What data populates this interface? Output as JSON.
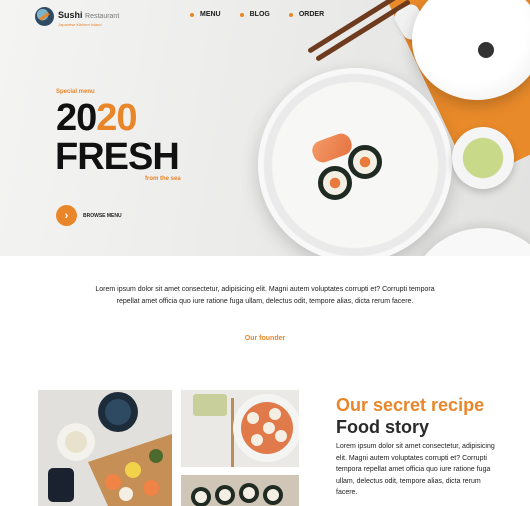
{
  "brand": {
    "name": "Sushi",
    "name_suffix": "Restaurant",
    "tagline": "Japanese Kitchen Island"
  },
  "nav": {
    "items": [
      {
        "label": "MENU"
      },
      {
        "label": "BLOG"
      },
      {
        "label": "ORDER"
      }
    ]
  },
  "hero": {
    "kicker": "Special menu",
    "year_part1": "20",
    "year_part2": "20",
    "headline": "FRESH",
    "subline": "from the sea",
    "cta_label": "BROWSE MENU",
    "cta_icon": "chevron-right-icon"
  },
  "intro": {
    "text": "Lorem ipsum dolor sit amet consectetur, adipisicing elit. Magni autem voluptates corrupti et? Corrupti tempora repellat amet officia quo iure ratione fuga ullam, delectus odit, tempore alias, dicta rerum facere.",
    "link_label": "Our founder"
  },
  "recipe": {
    "title_accent": "Our secret recipe",
    "title_main": "Food story",
    "text": "Lorem ipsum dolor sit amet consectetur, adipisicing elit. Magni autem voluptates corrupti et? Corrupti tempora repellat amet officia quo iure ratione fuga ullam, delectus odit, tempore alias, dicta rerum facere."
  },
  "colors": {
    "accent": "#e9862a",
    "text": "#222222"
  }
}
